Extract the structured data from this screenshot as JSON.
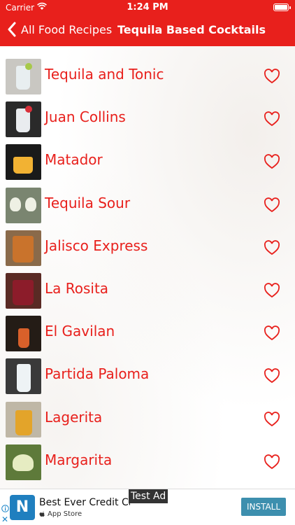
{
  "status_bar": {
    "carrier": "Carrier",
    "time": "1:24 PM",
    "battery_level": 1.0
  },
  "nav": {
    "back_label": "All Food Recipes",
    "title": "Tequila Based Cocktails"
  },
  "recipes": [
    {
      "name": "Tequila and Tonic"
    },
    {
      "name": "Juan Collins"
    },
    {
      "name": "Matador"
    },
    {
      "name": "Tequila Sour"
    },
    {
      "name": "Jalisco Express"
    },
    {
      "name": "La Rosita"
    },
    {
      "name": "El Gavilan"
    },
    {
      "name": "Partida Paloma"
    },
    {
      "name": "Lagerita"
    },
    {
      "name": "Margarita"
    }
  ],
  "ad": {
    "icon_letter": "N",
    "title": "Best Ever Credit Card",
    "store": "App Store",
    "label": "Test Ad",
    "install_label": "INSTALL"
  },
  "colors": {
    "brand_red": "#e8201c",
    "install_button": "#3d8fae"
  }
}
